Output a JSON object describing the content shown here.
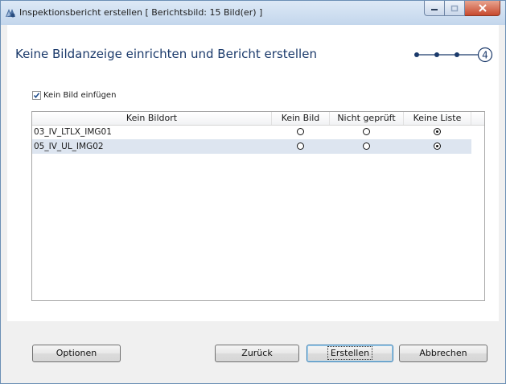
{
  "window": {
    "title": "Inspektionsbericht erstellen  [ Berichtsbild: 15 Bild(er) ]"
  },
  "heading": "Keine Bildanzeige einrichten und Bericht erstellen",
  "steps": {
    "current_label": "4"
  },
  "checkbox": {
    "label": "Kein Bild einfügen",
    "checked": true
  },
  "table": {
    "columns": [
      "Kein Bildort",
      "Kein Bild",
      "Nicht geprüft",
      "Keine Liste"
    ],
    "rows": [
      {
        "name": "03_IV_LTLX_IMG01",
        "selected": "Keine Liste"
      },
      {
        "name": "05_IV_UL_IMG02",
        "selected": "Keine Liste"
      }
    ]
  },
  "buttons": {
    "options": "Optionen",
    "back": "Zurück",
    "create": "Erstellen",
    "cancel": "Abbrechen"
  },
  "colors": {
    "titlebar": "#c3d6ec",
    "heading": "#1b3a6b",
    "alt_row": "#dde5f0",
    "close_button": "#c84a2e"
  },
  "icons": [
    "app-icon",
    "minimize-icon",
    "maximize-icon",
    "close-icon",
    "checkmark-icon",
    "step-indicator"
  ]
}
